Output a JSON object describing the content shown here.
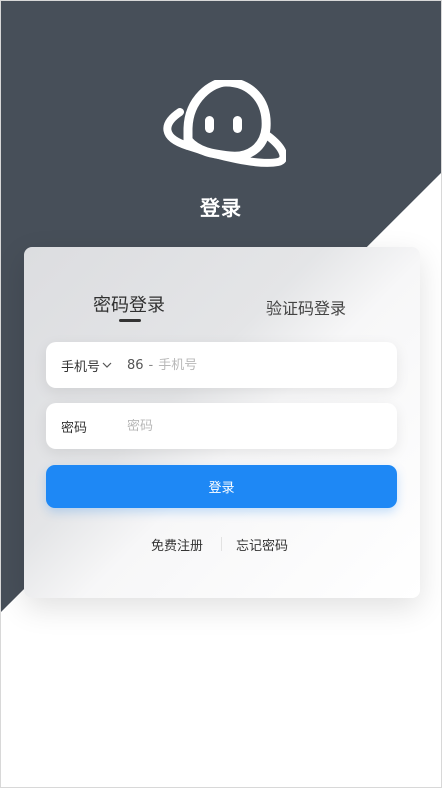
{
  "header": {
    "logo_icon": "ghost-planet-logo-icon",
    "title": "登录"
  },
  "tabs": [
    {
      "label": "密码登录",
      "active": true
    },
    {
      "label": "验证码登录",
      "active": false
    }
  ],
  "phone_field": {
    "prefix_label": "手机号",
    "prefix_icon": "chevron-down-icon",
    "country_code": "86",
    "separator": "-",
    "placeholder": "手机号",
    "value": ""
  },
  "password_field": {
    "label": "密码",
    "placeholder": "密码",
    "value": ""
  },
  "login_button": {
    "label": "登录",
    "color": "#1e88f5"
  },
  "links": {
    "register": "免费注册",
    "forgot": "忘记密码"
  },
  "colors": {
    "background_dark": "#474f59",
    "accent": "#1e88f5"
  }
}
